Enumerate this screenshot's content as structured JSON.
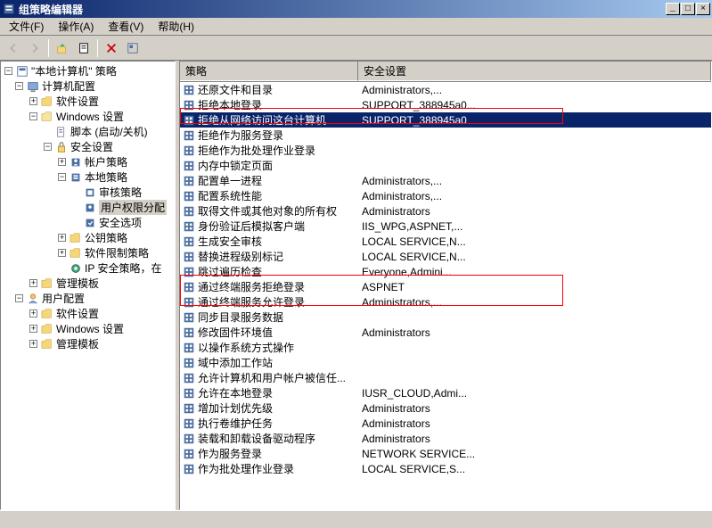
{
  "window": {
    "title": "组策略编辑器"
  },
  "menu": {
    "file": "文件(F)",
    "action": "操作(A)",
    "view": "查看(V)",
    "help": "帮助(H)"
  },
  "tree": {
    "root": "\"本地计算机\" 策略",
    "computer_config": "计算机配置",
    "software_settings": "软件设置",
    "windows_settings": "Windows 设置",
    "scripts": "脚本 (启动/关机)",
    "security_settings": "安全设置",
    "account_policies": "帐户策略",
    "local_policies": "本地策略",
    "audit_policy": "审核策略",
    "user_rights": "用户权限分配",
    "security_options": "安全选项",
    "public_key": "公钥策略",
    "software_restriction": "软件限制策略",
    "ip_security": "IP 安全策略，在",
    "admin_templates": "管理模板",
    "user_config": "用户配置",
    "software_settings2": "软件设置",
    "windows_settings2": "Windows 设置",
    "admin_templates2": "管理模板"
  },
  "list": {
    "header_policy": "策略",
    "header_security": "安全设置",
    "rows": [
      {
        "policy": "还原文件和目录",
        "security": "Administrators,..."
      },
      {
        "policy": "拒绝本地登录",
        "security": "SUPPORT_388945a0..."
      },
      {
        "policy": "拒绝从网络访问这台计算机",
        "security": "SUPPORT_388945a0",
        "selected": true
      },
      {
        "policy": "拒绝作为服务登录",
        "security": ""
      },
      {
        "policy": "拒绝作为批处理作业登录",
        "security": ""
      },
      {
        "policy": "内存中锁定页面",
        "security": ""
      },
      {
        "policy": "配置单一进程",
        "security": "Administrators,..."
      },
      {
        "policy": "配置系统性能",
        "security": "Administrators,..."
      },
      {
        "policy": "取得文件或其他对象的所有权",
        "security": "Administrators"
      },
      {
        "policy": "身份验证后模拟客户端",
        "security": "IIS_WPG,ASPNET,..."
      },
      {
        "policy": "生成安全审核",
        "security": "LOCAL SERVICE,N..."
      },
      {
        "policy": "替换进程级别标记",
        "security": "LOCAL SERVICE,N..."
      },
      {
        "policy": "跳过遍历检查",
        "security": "Everyone,Admini..."
      },
      {
        "policy": "通过终端服务拒绝登录",
        "security": "ASPNET"
      },
      {
        "policy": "通过终端服务允许登录",
        "security": "Administrators,..."
      },
      {
        "policy": "同步目录服务数据",
        "security": ""
      },
      {
        "policy": "修改固件环境值",
        "security": "Administrators"
      },
      {
        "policy": "以操作系统方式操作",
        "security": ""
      },
      {
        "policy": "域中添加工作站",
        "security": ""
      },
      {
        "policy": "允许计算机和用户帐户被信任...",
        "security": ""
      },
      {
        "policy": "允许在本地登录",
        "security": "IUSR_CLOUD,Admi..."
      },
      {
        "policy": "增加计划优先级",
        "security": "Administrators"
      },
      {
        "policy": "执行卷维护任务",
        "security": "Administrators"
      },
      {
        "policy": "装载和卸载设备驱动程序",
        "security": "Administrators"
      },
      {
        "policy": "作为服务登录",
        "security": "NETWORK SERVICE..."
      },
      {
        "policy": "作为批处理作业登录",
        "security": "LOCAL SERVICE,S..."
      }
    ]
  }
}
